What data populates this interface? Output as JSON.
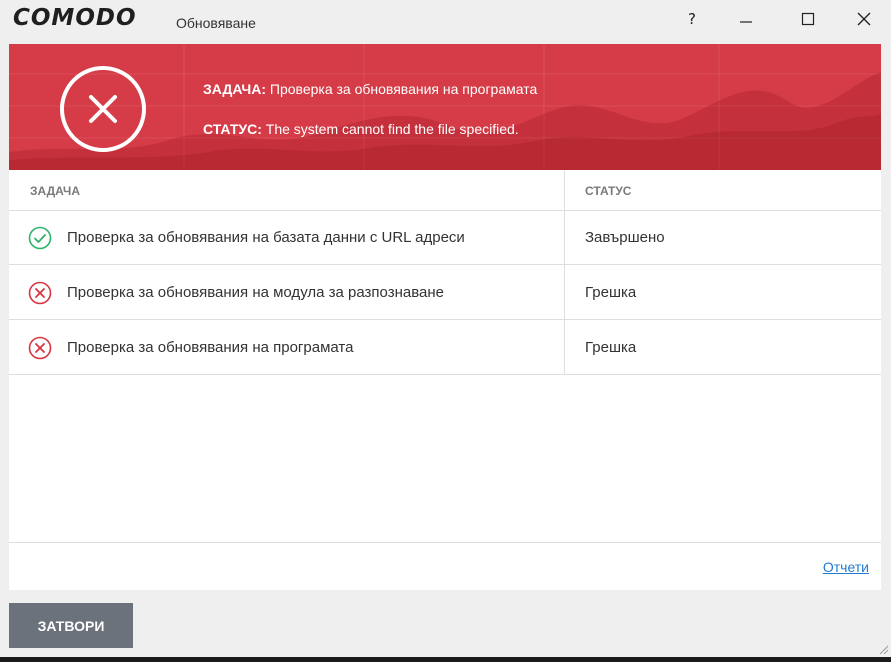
{
  "titlebar": {
    "logo": "COMODO",
    "title": "Обновяване",
    "help_label": "?"
  },
  "banner": {
    "task_label": "ЗАДАЧА:",
    "task_value": " Проверка за обновявания на програмата",
    "status_label": "СТАТУС:",
    "status_value": " The system cannot find the file specified.",
    "color": "#d53c47"
  },
  "table": {
    "columns": [
      "ЗАДАЧА",
      "СТАТУС"
    ],
    "rows": [
      {
        "task": "Проверка за обновявания на базата данни с URL адреси",
        "status": "Завършено",
        "icon": "check-circle-icon"
      },
      {
        "task": "Проверка за обновявания на модула за разпознаване",
        "status": "Грешка",
        "icon": "error-circle-icon"
      },
      {
        "task": "Проверка за обновявания на програмата",
        "status": "Грешка",
        "icon": "error-circle-icon"
      }
    ]
  },
  "footer": {
    "reports_link": "Отчети",
    "close_button": "ЗАТВОРИ"
  },
  "colors": {
    "success": "#2fb36b",
    "error": "#d9343f",
    "link": "#1f7bd1",
    "button": "#6c727c"
  }
}
